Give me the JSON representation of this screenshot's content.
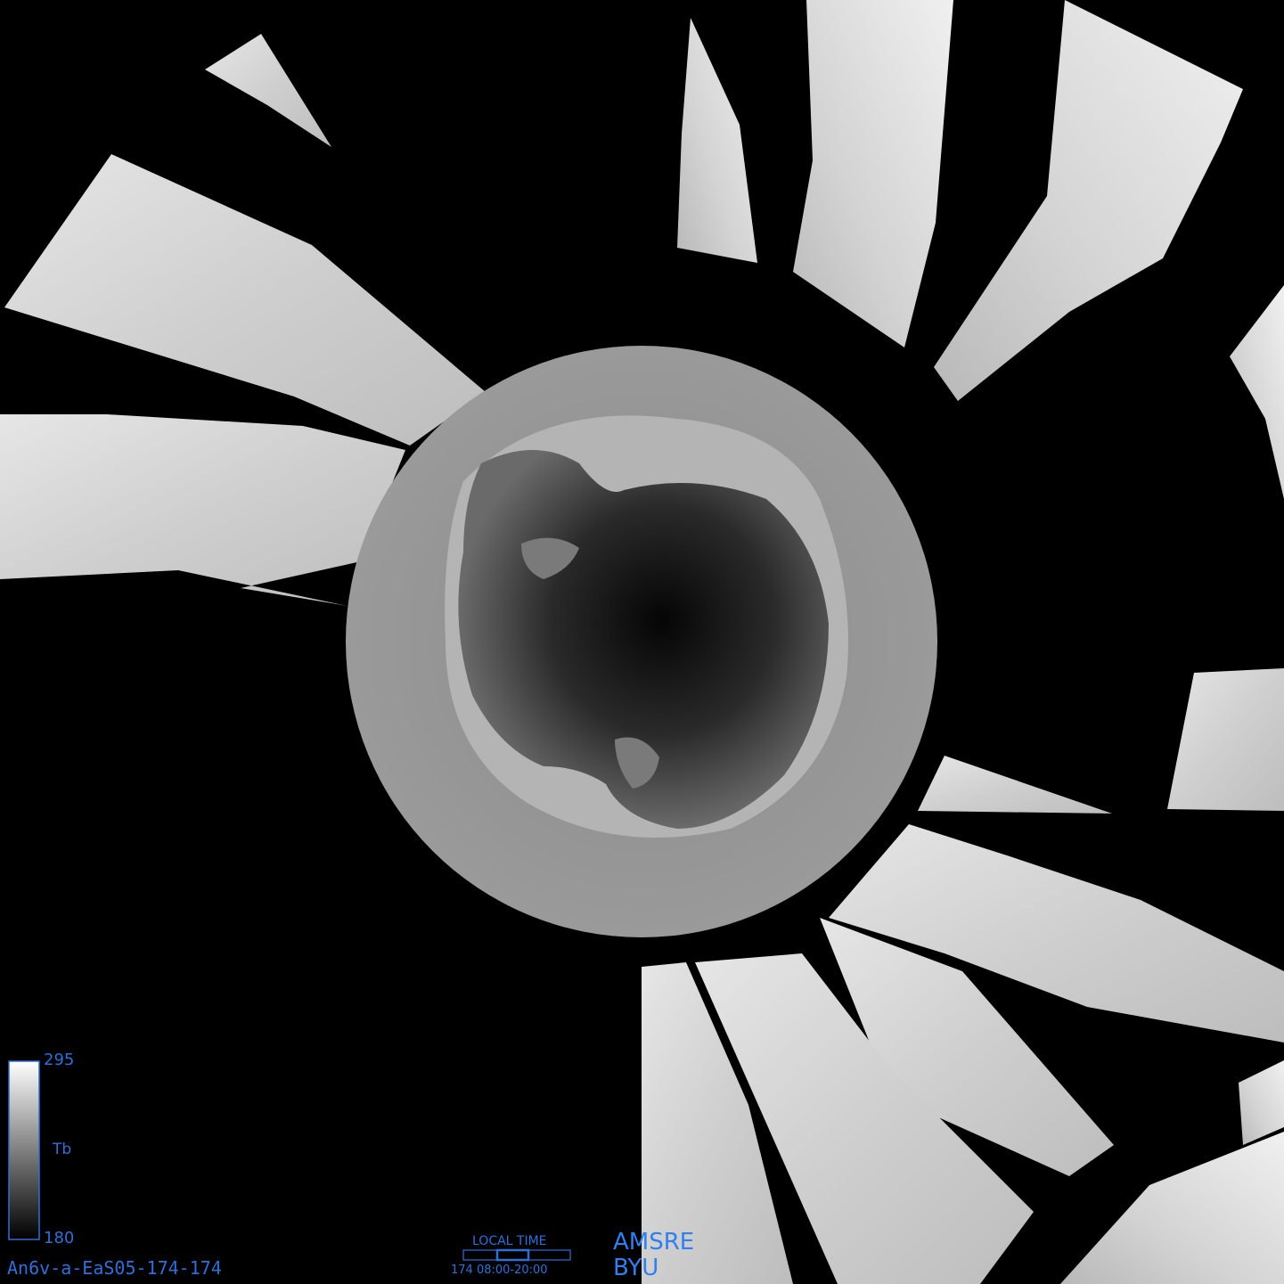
{
  "colorbar": {
    "max_label": "295",
    "quantity_label": "Tb",
    "min_label": "180",
    "max_value": 295,
    "min_value": 180
  },
  "product_id": "An6v-a-EaS05-174-174",
  "local_time": {
    "title": "LOCAL TIME",
    "value": "174 08:00-20:00"
  },
  "sensor": "AMSRE",
  "organization": "BYU",
  "colors": {
    "background": "#000000",
    "label_blue": "#2f6fd8",
    "label_bright_blue": "#2f7ff0"
  }
}
